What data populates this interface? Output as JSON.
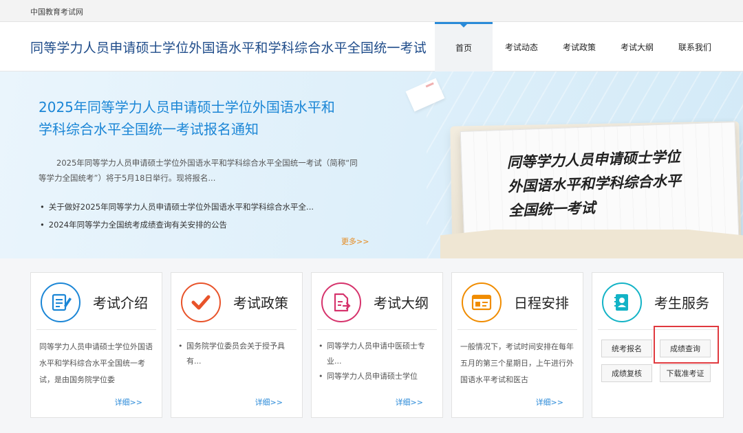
{
  "topbar": {
    "site_name": "中国教育考试网"
  },
  "header": {
    "title": "同等学力人员申请硕士学位外国语水平和学科综合水平全国统一考试",
    "nav": [
      {
        "label": "首页",
        "active": true
      },
      {
        "label": "考试动态"
      },
      {
        "label": "考试政策"
      },
      {
        "label": "考试大纲"
      },
      {
        "label": "联系我们"
      }
    ]
  },
  "banner": {
    "headline_line1": "2025年同等学力人员申请硕士学位外国语水平和",
    "headline_line2": "学科综合水平全国统一考试报名通知",
    "summary": "2025年同等学力人员申请硕士学位外国语水平和学科综合水平全国统一考试（简称“同等学力全国统考”）将于5月18日举行。现将报名...",
    "links": [
      "关于做好2025年同等学力人员申请硕士学位外国语水平和学科综合水平全...",
      "2024年同等学力全国统考成绩查询有关安排的公告"
    ],
    "more": "更多>>",
    "graphic_line1": "同等学力人员申请硕士学位",
    "graphic_line2": "外国语水平和学科综合水平",
    "graphic_line3": "全国统一考试"
  },
  "cards": [
    {
      "title": "考试介绍",
      "icon": "document-pen-icon",
      "body": "同等学力人员申请硕士学位外国语水平和学科综合水平全国统一考试，是由国务院学位委",
      "detail": "详细>>",
      "color": "#1b86d6"
    },
    {
      "title": "考试政策",
      "icon": "checkmark-icon",
      "list": [
        "国务院学位委员会关于授予具有..."
      ],
      "detail": "详细>>",
      "color": "#e8532a"
    },
    {
      "title": "考试大纲",
      "icon": "file-export-icon",
      "list": [
        "同等学力人员申请中医硕士专业...",
        "同等学力人员申请硕士学位"
      ],
      "detail": "详细>>",
      "color": "#d6336c"
    },
    {
      "title": "日程安排",
      "icon": "calendar-screen-icon",
      "body": "一般情况下，考试时间安排在每年五月的第三个星期日，上午进行外国语水平考试和医古",
      "detail": "详细>>",
      "color": "#f08c00"
    },
    {
      "title": "考生服务",
      "icon": "student-id-icon",
      "color": "#13b3c6",
      "buttons": [
        "统考报名",
        "成绩查询",
        "成绩复核",
        "下载准考证"
      ]
    }
  ]
}
